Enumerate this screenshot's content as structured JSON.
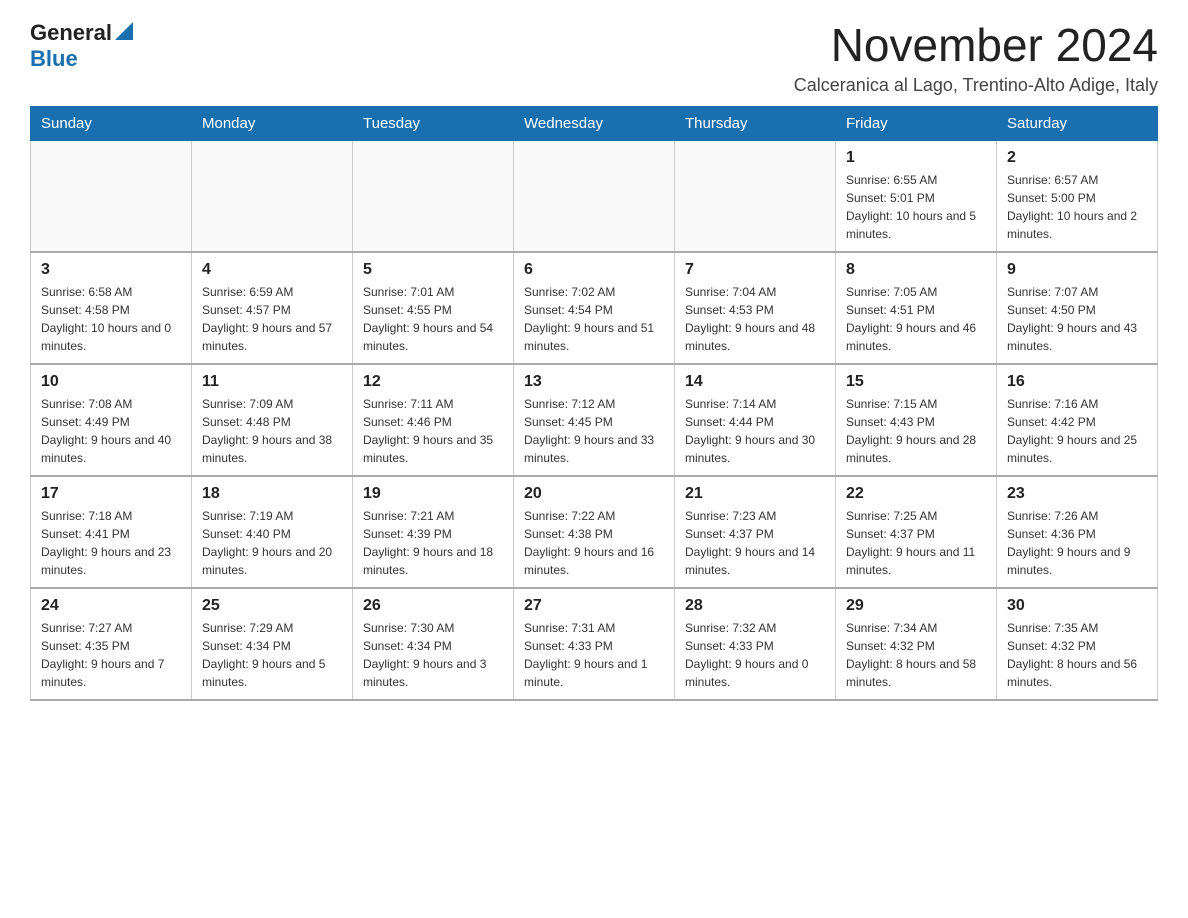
{
  "logo": {
    "general": "General",
    "blue": "Blue",
    "arrow": "▲"
  },
  "title": "November 2024",
  "location": "Calceranica al Lago, Trentino-Alto Adige, Italy",
  "weekdays": [
    "Sunday",
    "Monday",
    "Tuesday",
    "Wednesday",
    "Thursday",
    "Friday",
    "Saturday"
  ],
  "weeks": [
    [
      {
        "day": "",
        "info": ""
      },
      {
        "day": "",
        "info": ""
      },
      {
        "day": "",
        "info": ""
      },
      {
        "day": "",
        "info": ""
      },
      {
        "day": "",
        "info": ""
      },
      {
        "day": "1",
        "info": "Sunrise: 6:55 AM\nSunset: 5:01 PM\nDaylight: 10 hours and 5 minutes."
      },
      {
        "day": "2",
        "info": "Sunrise: 6:57 AM\nSunset: 5:00 PM\nDaylight: 10 hours and 2 minutes."
      }
    ],
    [
      {
        "day": "3",
        "info": "Sunrise: 6:58 AM\nSunset: 4:58 PM\nDaylight: 10 hours and 0 minutes."
      },
      {
        "day": "4",
        "info": "Sunrise: 6:59 AM\nSunset: 4:57 PM\nDaylight: 9 hours and 57 minutes."
      },
      {
        "day": "5",
        "info": "Sunrise: 7:01 AM\nSunset: 4:55 PM\nDaylight: 9 hours and 54 minutes."
      },
      {
        "day": "6",
        "info": "Sunrise: 7:02 AM\nSunset: 4:54 PM\nDaylight: 9 hours and 51 minutes."
      },
      {
        "day": "7",
        "info": "Sunrise: 7:04 AM\nSunset: 4:53 PM\nDaylight: 9 hours and 48 minutes."
      },
      {
        "day": "8",
        "info": "Sunrise: 7:05 AM\nSunset: 4:51 PM\nDaylight: 9 hours and 46 minutes."
      },
      {
        "day": "9",
        "info": "Sunrise: 7:07 AM\nSunset: 4:50 PM\nDaylight: 9 hours and 43 minutes."
      }
    ],
    [
      {
        "day": "10",
        "info": "Sunrise: 7:08 AM\nSunset: 4:49 PM\nDaylight: 9 hours and 40 minutes."
      },
      {
        "day": "11",
        "info": "Sunrise: 7:09 AM\nSunset: 4:48 PM\nDaylight: 9 hours and 38 minutes."
      },
      {
        "day": "12",
        "info": "Sunrise: 7:11 AM\nSunset: 4:46 PM\nDaylight: 9 hours and 35 minutes."
      },
      {
        "day": "13",
        "info": "Sunrise: 7:12 AM\nSunset: 4:45 PM\nDaylight: 9 hours and 33 minutes."
      },
      {
        "day": "14",
        "info": "Sunrise: 7:14 AM\nSunset: 4:44 PM\nDaylight: 9 hours and 30 minutes."
      },
      {
        "day": "15",
        "info": "Sunrise: 7:15 AM\nSunset: 4:43 PM\nDaylight: 9 hours and 28 minutes."
      },
      {
        "day": "16",
        "info": "Sunrise: 7:16 AM\nSunset: 4:42 PM\nDaylight: 9 hours and 25 minutes."
      }
    ],
    [
      {
        "day": "17",
        "info": "Sunrise: 7:18 AM\nSunset: 4:41 PM\nDaylight: 9 hours and 23 minutes."
      },
      {
        "day": "18",
        "info": "Sunrise: 7:19 AM\nSunset: 4:40 PM\nDaylight: 9 hours and 20 minutes."
      },
      {
        "day": "19",
        "info": "Sunrise: 7:21 AM\nSunset: 4:39 PM\nDaylight: 9 hours and 18 minutes."
      },
      {
        "day": "20",
        "info": "Sunrise: 7:22 AM\nSunset: 4:38 PM\nDaylight: 9 hours and 16 minutes."
      },
      {
        "day": "21",
        "info": "Sunrise: 7:23 AM\nSunset: 4:37 PM\nDaylight: 9 hours and 14 minutes."
      },
      {
        "day": "22",
        "info": "Sunrise: 7:25 AM\nSunset: 4:37 PM\nDaylight: 9 hours and 11 minutes."
      },
      {
        "day": "23",
        "info": "Sunrise: 7:26 AM\nSunset: 4:36 PM\nDaylight: 9 hours and 9 minutes."
      }
    ],
    [
      {
        "day": "24",
        "info": "Sunrise: 7:27 AM\nSunset: 4:35 PM\nDaylight: 9 hours and 7 minutes."
      },
      {
        "day": "25",
        "info": "Sunrise: 7:29 AM\nSunset: 4:34 PM\nDaylight: 9 hours and 5 minutes."
      },
      {
        "day": "26",
        "info": "Sunrise: 7:30 AM\nSunset: 4:34 PM\nDaylight: 9 hours and 3 minutes."
      },
      {
        "day": "27",
        "info": "Sunrise: 7:31 AM\nSunset: 4:33 PM\nDaylight: 9 hours and 1 minute."
      },
      {
        "day": "28",
        "info": "Sunrise: 7:32 AM\nSunset: 4:33 PM\nDaylight: 9 hours and 0 minutes."
      },
      {
        "day": "29",
        "info": "Sunrise: 7:34 AM\nSunset: 4:32 PM\nDaylight: 8 hours and 58 minutes."
      },
      {
        "day": "30",
        "info": "Sunrise: 7:35 AM\nSunset: 4:32 PM\nDaylight: 8 hours and 56 minutes."
      }
    ]
  ]
}
